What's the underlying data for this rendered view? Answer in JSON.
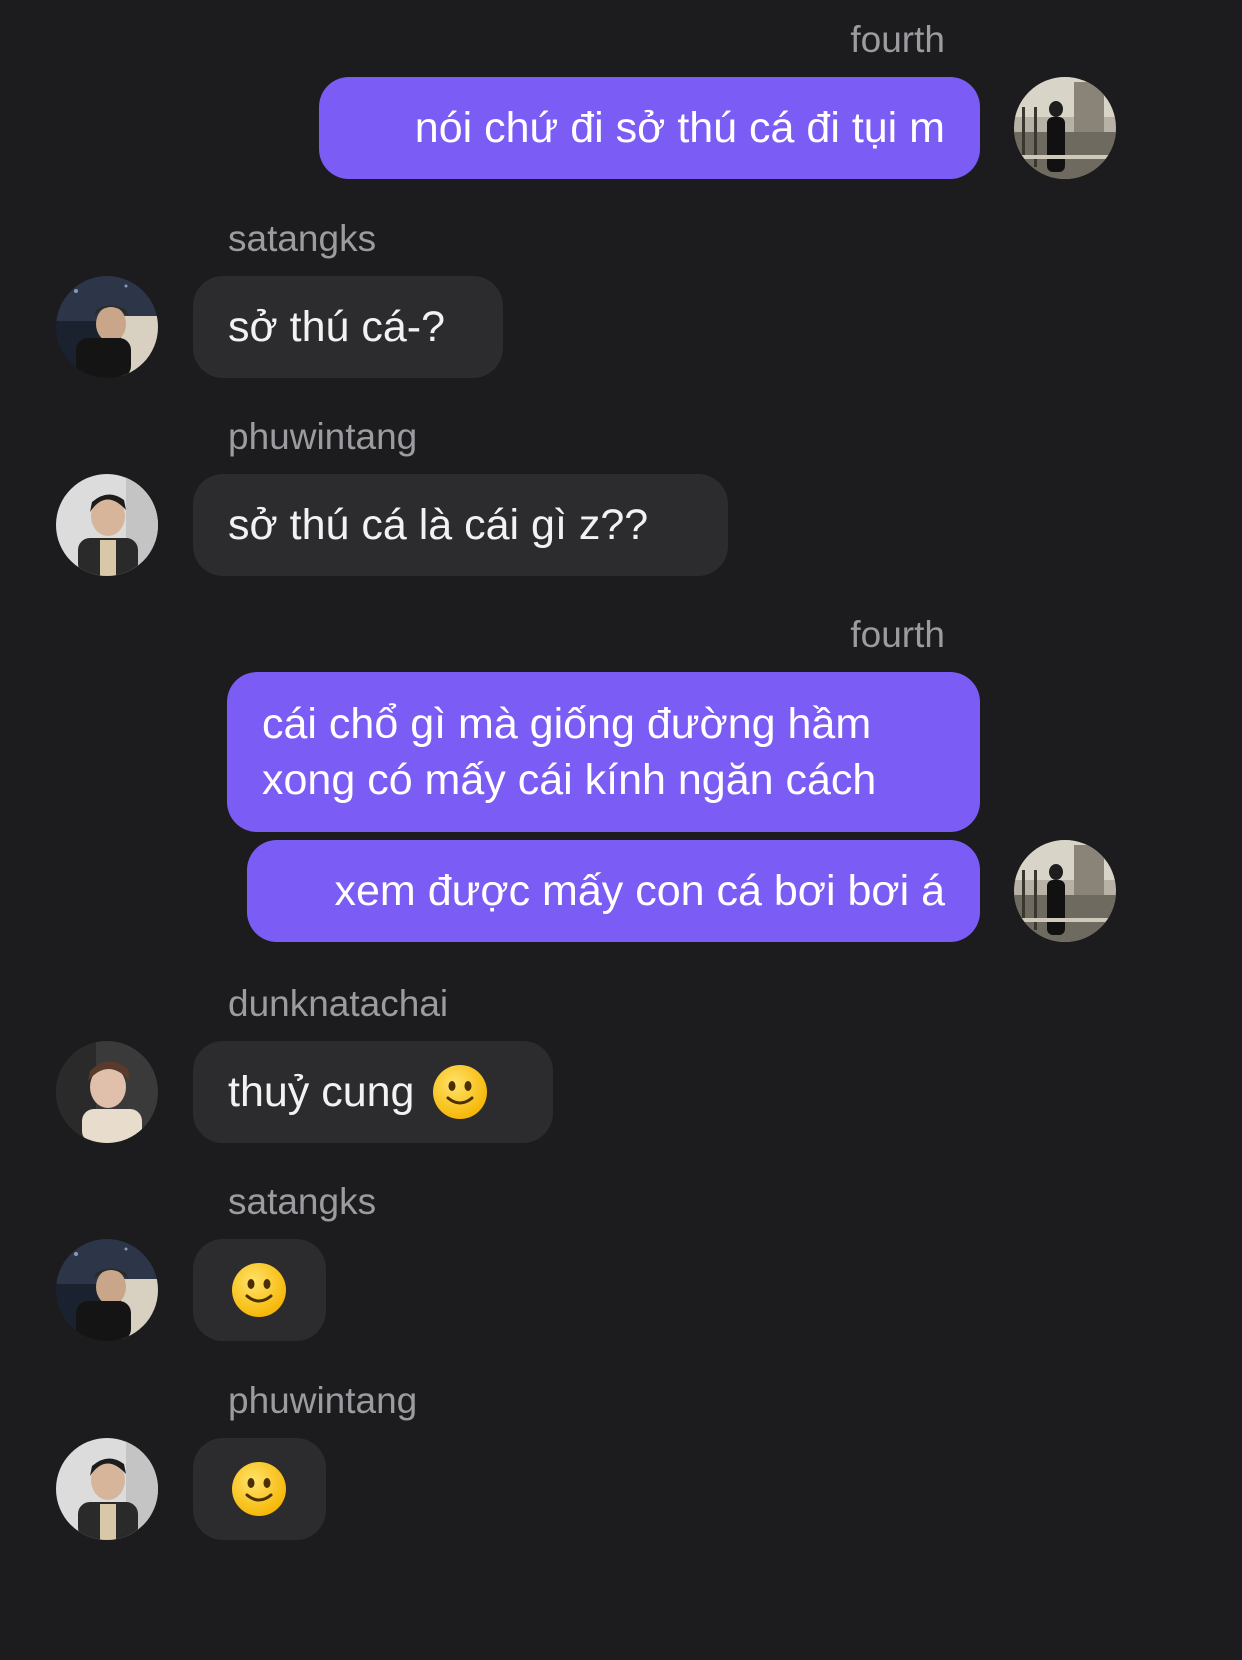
{
  "messages": [
    {
      "sender": "fourth",
      "side": "right",
      "lines": [
        "nói chứ đi sở thú cá đi tụi m"
      ]
    },
    {
      "sender": "satangks",
      "side": "left",
      "lines": [
        "sở thú cá-?"
      ]
    },
    {
      "sender": "phuwintang",
      "side": "left",
      "lines": [
        "sở thú cá là cái gì z??"
      ]
    },
    {
      "sender": "fourth",
      "side": "right",
      "lines": [
        "cái chổ gì mà giống đường hầm",
        "xong có mấy cái kính ngăn cách"
      ]
    },
    {
      "sender": "fourth",
      "side": "right",
      "lines": [
        "xem được mấy con cá bơi bơi á"
      ]
    },
    {
      "sender": "dunknatachai",
      "side": "left",
      "lines": [
        "thuỷ cung"
      ],
      "emoji": "slightly-smiling-face"
    },
    {
      "sender": "satangks",
      "side": "left",
      "lines": [],
      "emoji": "slightly-smiling-face"
    },
    {
      "sender": "phuwintang",
      "side": "left",
      "lines": [],
      "emoji": "slightly-smiling-face"
    }
  ],
  "colors": {
    "background": "#1c1c1e",
    "outgoing_bubble": "#7b5cf5",
    "incoming_bubble": "#2c2c2e",
    "username": "#9b9ba0"
  }
}
